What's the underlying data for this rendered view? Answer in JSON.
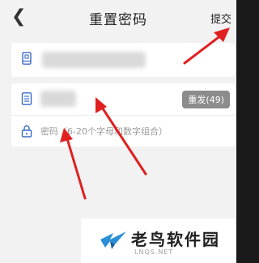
{
  "header": {
    "back_icon": "chevron-left-icon",
    "title": "重置密码",
    "submit_label": "提交"
  },
  "form": {
    "phone_icon": "phone-icon",
    "code_icon": "document-icon",
    "resend_label": "重发(49)",
    "lock_icon": "lock-icon",
    "password_placeholder": "密码（6-20个字母和数字组合）"
  },
  "watermark": {
    "text": "老鸟软件园",
    "sub": "LNQS.NET"
  },
  "colors": {
    "accent_icon": "#3a6cc8",
    "arrow": "#e02020",
    "resend_bg": "#8c8c8c"
  }
}
